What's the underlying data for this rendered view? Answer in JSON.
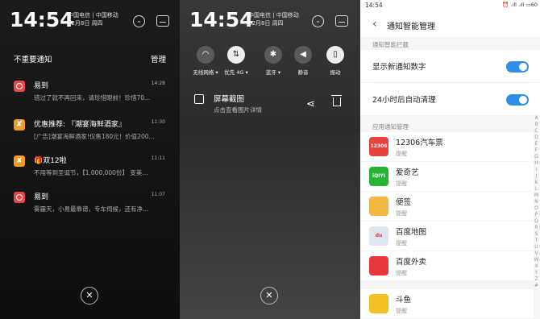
{
  "panel1": {
    "time": "14:54",
    "carrier_line1": "中国电信 | 中国移动",
    "carrier_line2": "12月8日 周四",
    "section_title": "不重要通知",
    "manage_label": "管理",
    "notifications": [
      {
        "icon": "yidao-icon",
        "title": "易到",
        "time": "14:28",
        "body": "错过了就不再回来，请珍惜眼前！珍惜70..."
      },
      {
        "icon": "youhui-icon",
        "title": "优惠推荐: 『潮宴海鲜酒家』",
        "time": "11:30",
        "body": "[广告]潮宴海鲜酒家!仅售180元！价值200..."
      },
      {
        "icon": "shuang12-icon",
        "title": "🎁双12啦",
        "time": "11:11",
        "body": "不用等到圣诞节，【1,000,000份】 变美..."
      },
      {
        "icon": "yidao-icon",
        "title": "易到",
        "time": "11:07",
        "body": "雾霾天，小易最靠谱，专车伺候，还有净..."
      }
    ],
    "close_glyph": "✕"
  },
  "panel2": {
    "time": "14:54",
    "carrier_line1": "中国电信 | 中国移动",
    "carrier_line2": "12月8日 周四",
    "toggles": [
      {
        "label": "无线网络 ▾",
        "glyph": "◠",
        "on": false
      },
      {
        "label": "优先 4G ▾",
        "glyph": "⇅",
        "on": true
      },
      {
        "label": "蓝牙 ▾",
        "glyph": "✱",
        "on": false
      },
      {
        "label": "静音",
        "glyph": "◀",
        "on": false
      },
      {
        "label": "振动",
        "glyph": "▯",
        "on": true
      }
    ],
    "screenshot_title": "屏幕截图",
    "screenshot_sub": "点击查看图片详情",
    "close_glyph": "✕"
  },
  "panel3": {
    "status_time": "14:54",
    "status_right": "⏰ .ıll .ıll ▭60",
    "back_glyph": "‹",
    "title": "通知智能管理",
    "section1": "通知智能拦截",
    "settings": [
      {
        "label": "显示新通知数字",
        "on": true
      },
      {
        "label": "24小时后自动清理",
        "on": true
      }
    ],
    "section2": "应用通知管理",
    "apps": [
      {
        "name": "12306汽车票",
        "sub": "提醒",
        "icon_text": "12306",
        "color": "#e8423f"
      },
      {
        "name": "爱奇艺",
        "sub": "提醒",
        "icon_text": "iQIYI",
        "color": "#27b335"
      },
      {
        "name": "便签",
        "sub": "提醒",
        "icon_text": "",
        "color": "#f5b543"
      },
      {
        "name": "百度地图",
        "sub": "提醒",
        "icon_text": "du",
        "color": "#dde6f2"
      },
      {
        "name": "百度外卖",
        "sub": "提醒",
        "icon_text": "",
        "color": "#e8373c"
      },
      {
        "name": "斗鱼",
        "sub": "提醒",
        "icon_text": "",
        "color": "#f3c122"
      }
    ],
    "alphabet": [
      "A",
      "B",
      "C",
      "D",
      "E",
      "F",
      "G",
      "H",
      "I",
      "J",
      "K",
      "L",
      "M",
      "N",
      "O",
      "P",
      "Q",
      "R",
      "S",
      "T",
      "U",
      "V",
      "W",
      "X",
      "Y",
      "Z",
      "#"
    ]
  }
}
